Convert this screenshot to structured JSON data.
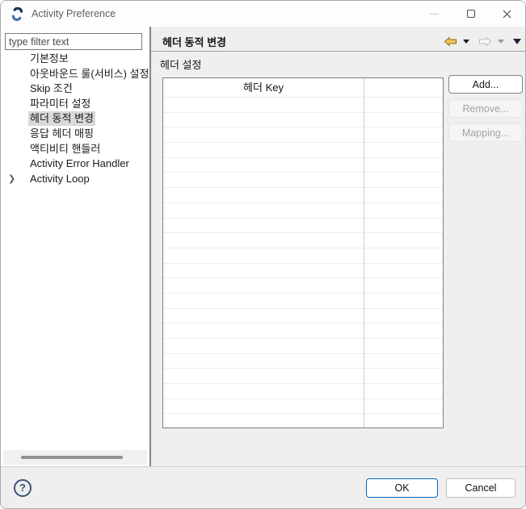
{
  "window": {
    "title": "Activity Preference"
  },
  "sidebar": {
    "filter_placeholder": "type filter text",
    "tree": [
      {
        "label": "기본정보"
      },
      {
        "label": "아웃바운드 룰(서비스) 설정"
      },
      {
        "label": "Skip 조건"
      },
      {
        "label": "파라미터 설정"
      },
      {
        "label": "헤더 동적 변경",
        "selected": true
      },
      {
        "label": "응답 헤더 매핑"
      },
      {
        "label": "액티비티 핸들러"
      },
      {
        "label": "Activity Error Handler"
      },
      {
        "label": "Activity Loop",
        "expandable": true
      }
    ]
  },
  "main": {
    "page_title": "헤더 동적 변경",
    "section_title": "헤더 설정",
    "table": {
      "columns": [
        "헤더 Key",
        ""
      ],
      "rows": []
    },
    "buttons": {
      "add": "Add...",
      "remove": "Remove...",
      "mapping": "Mapping..."
    }
  },
  "footer": {
    "help": "?",
    "ok": "OK",
    "cancel": "Cancel"
  },
  "colors": {
    "accent": "#0067c0",
    "tree_selection": "#d9d9d9",
    "panel_bg": "#efefef",
    "back_arrow_fill": "#f0c75e",
    "back_arrow_stroke": "#8a6d1f"
  }
}
